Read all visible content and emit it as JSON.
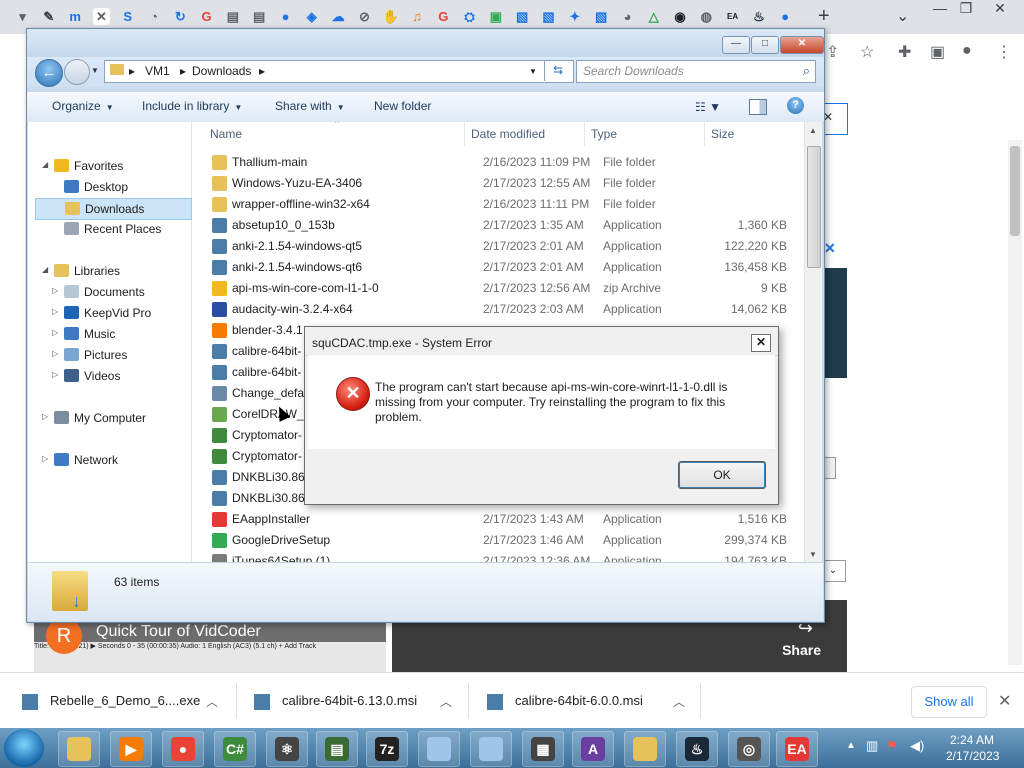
{
  "browser": {
    "tab_icons": [
      {
        "name": "tab-icon-1",
        "color": "#5f6368",
        "glyph": "▾"
      },
      {
        "name": "tab-icon-2",
        "color": "#3c4043",
        "glyph": "✎"
      },
      {
        "name": "tab-icon-3",
        "color": "#1a73e8",
        "glyph": "m"
      },
      {
        "name": "tab-icon-4",
        "color": "#5f6368",
        "glyph": "✕"
      },
      {
        "name": "tab-icon-5",
        "color": "#1a73e8",
        "glyph": "S"
      },
      {
        "name": "tab-icon-6",
        "color": "#5f6368",
        "glyph": "◔"
      },
      {
        "name": "tab-icon-7",
        "color": "#1a73e8",
        "glyph": "↻"
      },
      {
        "name": "tab-icon-8",
        "color": "#ea4335",
        "glyph": "G"
      },
      {
        "name": "tab-icon-9",
        "color": "#5f6368",
        "glyph": "▤"
      },
      {
        "name": "tab-icon-10",
        "color": "#5f6368",
        "glyph": "▤"
      },
      {
        "name": "tab-icon-11",
        "color": "#1a73e8",
        "glyph": "●"
      },
      {
        "name": "tab-icon-12",
        "color": "#1a73e8",
        "glyph": "◈"
      },
      {
        "name": "tab-icon-13",
        "color": "#1a73e8",
        "glyph": "☁"
      },
      {
        "name": "tab-icon-14",
        "color": "#5f6368",
        "glyph": "⊘"
      },
      {
        "name": "tab-icon-15",
        "color": "#f6b73c",
        "glyph": "✋"
      },
      {
        "name": "tab-icon-16",
        "color": "#f57c00",
        "glyph": "♫"
      },
      {
        "name": "tab-icon-17",
        "color": "#ea4335",
        "glyph": "G"
      },
      {
        "name": "tab-icon-18",
        "color": "#1a73e8",
        "glyph": "⛭"
      },
      {
        "name": "tab-icon-19",
        "color": "#34a853",
        "glyph": "▣"
      },
      {
        "name": "tab-icon-20",
        "color": "#1a73e8",
        "glyph": "▧"
      },
      {
        "name": "tab-icon-21",
        "color": "#1a73e8",
        "glyph": "▧"
      },
      {
        "name": "tab-icon-22",
        "color": "#1a73e8",
        "glyph": "✦"
      },
      {
        "name": "tab-icon-23",
        "color": "#1a73e8",
        "glyph": "▧"
      },
      {
        "name": "tab-icon-24",
        "color": "#5f6368",
        "glyph": "◕"
      },
      {
        "name": "tab-icon-25",
        "color": "#34a853",
        "glyph": "△"
      },
      {
        "name": "tab-icon-26",
        "color": "#202124",
        "glyph": "◉"
      },
      {
        "name": "tab-icon-27",
        "color": "#5f6368",
        "glyph": "◍"
      },
      {
        "name": "tab-icon-28",
        "color": "#202124",
        "glyph": "EA"
      },
      {
        "name": "tab-icon-29",
        "color": "#1b2838",
        "glyph": "♨"
      },
      {
        "name": "tab-icon-30",
        "color": "#1a73e8",
        "glyph": "●"
      }
    ],
    "new_tab": "+",
    "tab_dropdown": "⌄",
    "window_controls": [
      "—",
      "❐",
      "✕"
    ]
  },
  "explorer": {
    "caption_buttons": [
      "—",
      "□",
      "✕"
    ],
    "path": [
      "VM1",
      "Downloads"
    ],
    "search_placeholder": "Search Downloads",
    "commands": [
      {
        "label": "Organize",
        "dropdown": "▼"
      },
      {
        "label": "Include in library",
        "dropdown": "▼"
      },
      {
        "label": "Share with",
        "dropdown": "▼"
      },
      {
        "label": "New folder",
        "dropdown": ""
      }
    ],
    "nav": [
      {
        "label": "Favorites",
        "level": 0,
        "expand": "◢",
        "icon": "star-icon",
        "color": "#f2b820"
      },
      {
        "label": "Desktop",
        "level": 1,
        "expand": "",
        "icon": "desktop-icon",
        "color": "#3e7bc4"
      },
      {
        "label": "Downloads",
        "level": 1,
        "expand": "",
        "icon": "downloads-icon",
        "color": "#e7c15a",
        "selected": true
      },
      {
        "label": "Recent Places",
        "level": 1,
        "expand": "",
        "icon": "recent-places-icon",
        "color": "#9aa6b3"
      },
      {
        "label": "Libraries",
        "level": 0,
        "expand": "◢",
        "icon": "libraries-icon",
        "color": "#e7c15a"
      },
      {
        "label": "Documents",
        "level": 1,
        "expand": "▷",
        "icon": "documents-icon",
        "color": "#b8c7d8"
      },
      {
        "label": "KeepVid Pro",
        "level": 1,
        "expand": "▷",
        "icon": "keepvid-icon",
        "color": "#1f63b5"
      },
      {
        "label": "Music",
        "level": 1,
        "expand": "▷",
        "icon": "music-icon",
        "color": "#3e7bc4"
      },
      {
        "label": "Pictures",
        "level": 1,
        "expand": "▷",
        "icon": "pictures-icon",
        "color": "#7aa6d4"
      },
      {
        "label": "Videos",
        "level": 1,
        "expand": "▷",
        "icon": "videos-icon",
        "color": "#3d5f8a"
      },
      {
        "label": "My Computer",
        "level": 0,
        "expand": "▷",
        "icon": "computer-icon",
        "color": "#7a8ca0"
      },
      {
        "label": "Network",
        "level": 0,
        "expand": "▷",
        "icon": "network-icon",
        "color": "#3e7bc4"
      }
    ],
    "columns": [
      "Name",
      "Date modified",
      "Type",
      "Size"
    ],
    "files": [
      {
        "name": "Thallium-main",
        "date": "2/16/2023 11:09 PM",
        "type": "File folder",
        "size": "",
        "color": "#e7c15a"
      },
      {
        "name": "Windows-Yuzu-EA-3406",
        "date": "2/17/2023 12:55 AM",
        "type": "File folder",
        "size": "",
        "color": "#e7c15a"
      },
      {
        "name": "wrapper-offline-win32-x64",
        "date": "2/16/2023 11:11 PM",
        "type": "File folder",
        "size": "",
        "color": "#e7c15a"
      },
      {
        "name": "absetup10_0_153b",
        "date": "2/17/2023 1:35 AM",
        "type": "Application",
        "size": "1,360 KB",
        "color": "#4a7ea8"
      },
      {
        "name": "anki-2.1.54-windows-qt5",
        "date": "2/17/2023 2:01 AM",
        "type": "Application",
        "size": "122,220 KB",
        "color": "#4a7ea8"
      },
      {
        "name": "anki-2.1.54-windows-qt6",
        "date": "2/17/2023 2:01 AM",
        "type": "Application",
        "size": "136,458 KB",
        "color": "#4a7ea8"
      },
      {
        "name": "api-ms-win-core-com-l1-1-0",
        "date": "2/17/2023 12:56 AM",
        "type": "zip Archive",
        "size": "9 KB",
        "color": "#f2b820"
      },
      {
        "name": "audacity-win-3.2.4-x64",
        "date": "2/17/2023 2:03 AM",
        "type": "Application",
        "size": "14,062 KB",
        "color": "#2a4fa0"
      },
      {
        "name": "blender-3.4.1",
        "date": "",
        "type": "",
        "size": "",
        "color": "#f57c00"
      },
      {
        "name": "calibre-64bit-",
        "date": "",
        "type": "",
        "size": "",
        "color": "#4a7ea8"
      },
      {
        "name": "calibre-64bit-",
        "date": "",
        "type": "",
        "size": "",
        "color": "#4a7ea8"
      },
      {
        "name": "Change_defa",
        "date": "",
        "type": "",
        "size": "",
        "color": "#6a8aa8"
      },
      {
        "name": "CorelDRAW_",
        "date": "",
        "type": "",
        "size": "",
        "color": "#6aa84f"
      },
      {
        "name": "Cryptomator-",
        "date": "",
        "type": "",
        "size": "",
        "color": "#3f8a3f"
      },
      {
        "name": "Cryptomator-",
        "date": "",
        "type": "",
        "size": "",
        "color": "#3f8a3f"
      },
      {
        "name": "DNKBLi30.86",
        "date": "",
        "type": "",
        "size": "",
        "color": "#4a7ea8"
      },
      {
        "name": "DNKBLi30.86",
        "date": "",
        "type": "",
        "size": "",
        "color": "#4a7ea8"
      },
      {
        "name": "EAappInstaller",
        "date": "2/17/2023 1:43 AM",
        "type": "Application",
        "size": "1,516 KB",
        "color": "#e53935"
      },
      {
        "name": "GoogleDriveSetup",
        "date": "2/17/2023 1:46 AM",
        "type": "Application",
        "size": "299,374 KB",
        "color": "#34a853"
      },
      {
        "name": "iTunes64Setup (1)",
        "date": "2/17/2023 12:36 AM",
        "type": "Application",
        "size": "194,763 KB",
        "color": "#7b7b7b"
      }
    ],
    "status": "63 items"
  },
  "dialog": {
    "title": "squCDAC.tmp.exe - System Error",
    "close": "✕",
    "icon_glyph": "✕",
    "message": "The program can't start because api-ms-win-core-winrt-l1-1-0.dll is missing from your computer. Try reinstalling the program to fix this problem.",
    "ok": "OK"
  },
  "page": {
    "video_avatar": "R",
    "video_title": "Quick Tour of VidCoder",
    "video_share": "Share",
    "video_share_icon": "↪",
    "video_strip_text": "Title: 1 (01:27:21)  ▶ Seconds  0 - 35 (00:00:35)   Audio: 1 English (AC3) (5.1 ch)  + Add Track"
  },
  "downloads": {
    "items": [
      "Rebelle_6_Demo_6....exe",
      "calibre-64bit-6.13.0.msi",
      "calibre-64bit-6.0.0.msi"
    ],
    "show_all": "Show all",
    "close": "✕"
  },
  "taskbar": {
    "apps": [
      {
        "name": "explorer",
        "color": "#e7c15a",
        "glyph": ""
      },
      {
        "name": "media",
        "color": "#f57c00",
        "glyph": "▶"
      },
      {
        "name": "chrome",
        "color": "#ea4335",
        "glyph": "●"
      },
      {
        "name": "csharp",
        "color": "#3d8b3d",
        "glyph": "C#"
      },
      {
        "name": "atom",
        "color": "#444444",
        "glyph": "⚛"
      },
      {
        "name": "terminal",
        "color": "#3a6b35",
        "glyph": "▤"
      },
      {
        "name": "7zip",
        "color": "#222222",
        "glyph": "7z"
      },
      {
        "name": "notes",
        "color": "#9fc5e8",
        "glyph": ""
      },
      {
        "name": "notes2",
        "color": "#9fc5e8",
        "glyph": ""
      },
      {
        "name": "chip",
        "color": "#444444",
        "glyph": "▦"
      },
      {
        "name": "arc",
        "color": "#6a3fa0",
        "glyph": "A"
      },
      {
        "name": "folder2",
        "color": "#e7c15a",
        "glyph": ""
      },
      {
        "name": "steam",
        "color": "#1b2838",
        "glyph": "♨"
      },
      {
        "name": "spiral",
        "color": "#555555",
        "glyph": "◎"
      },
      {
        "name": "ea",
        "color": "#e53935",
        "glyph": "EA"
      }
    ],
    "time": "2:24 AM",
    "date": "2/17/2023"
  }
}
